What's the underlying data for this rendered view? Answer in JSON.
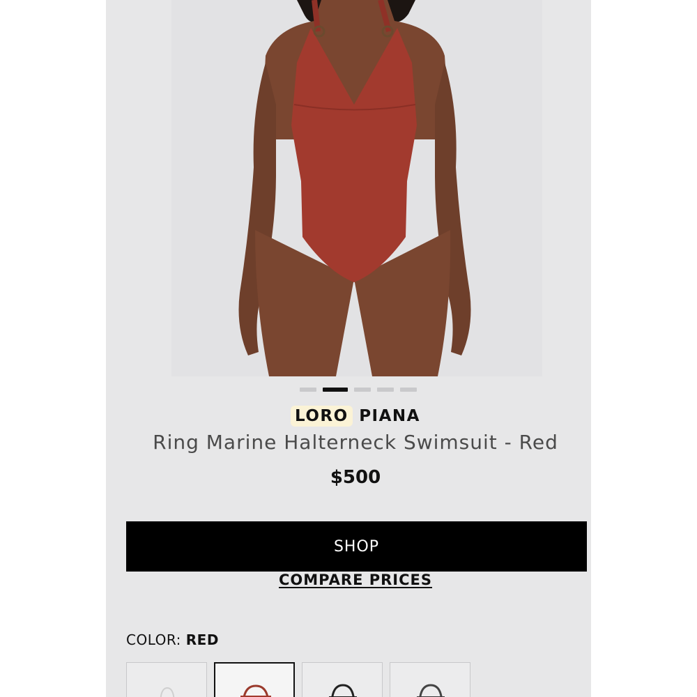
{
  "product": {
    "brand_part1": "LORO",
    "brand_part2": "PIANA",
    "name": "Ring Marine Halterneck Swimsuit - Red",
    "price": "$500",
    "image_colors": {
      "background": "#e2e2e4",
      "skin": "#7a4630",
      "garment": "#a23a2e"
    }
  },
  "gallery": {
    "dot_count": 5,
    "active_index": 1
  },
  "actions": {
    "shop_label": "SHOP",
    "compare_label": "COMPARE PRICES"
  },
  "color": {
    "label": "COLOR:",
    "value": "RED",
    "swatches": [
      {
        "name": "white",
        "selected": false
      },
      {
        "name": "red",
        "selected": true
      },
      {
        "name": "black",
        "selected": false
      },
      {
        "name": "dark-gray",
        "selected": false
      }
    ]
  }
}
